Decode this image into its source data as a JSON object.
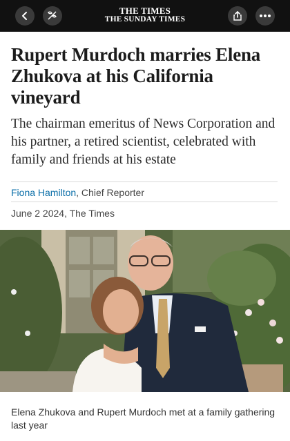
{
  "masthead": {
    "line1": "THE TIMES",
    "line2": "THE SUNDAY TIMES"
  },
  "toolbar": {
    "back_icon": "chevron-left-icon",
    "reader_icon": "reader-mode-icon",
    "share_icon": "share-icon",
    "more_icon": "more-horizontal-icon"
  },
  "article": {
    "headline": "Rupert Murdoch marries Elena Zhukova at his California vineyard",
    "standfirst": "The chairman emeritus of News Corporation and his partner, a retired scientist, celebrated with family and friends at his estate",
    "author": "Fiona Hamilton",
    "author_role": ", Chief Reporter",
    "date": "June 2 2024, The Times",
    "caption": "Elena Zhukova and Rupert Murdoch met at a family gathering last year"
  },
  "colors": {
    "topbar": "#111111",
    "author_link": "#0a6ea8",
    "text": "#1a1a1a"
  }
}
